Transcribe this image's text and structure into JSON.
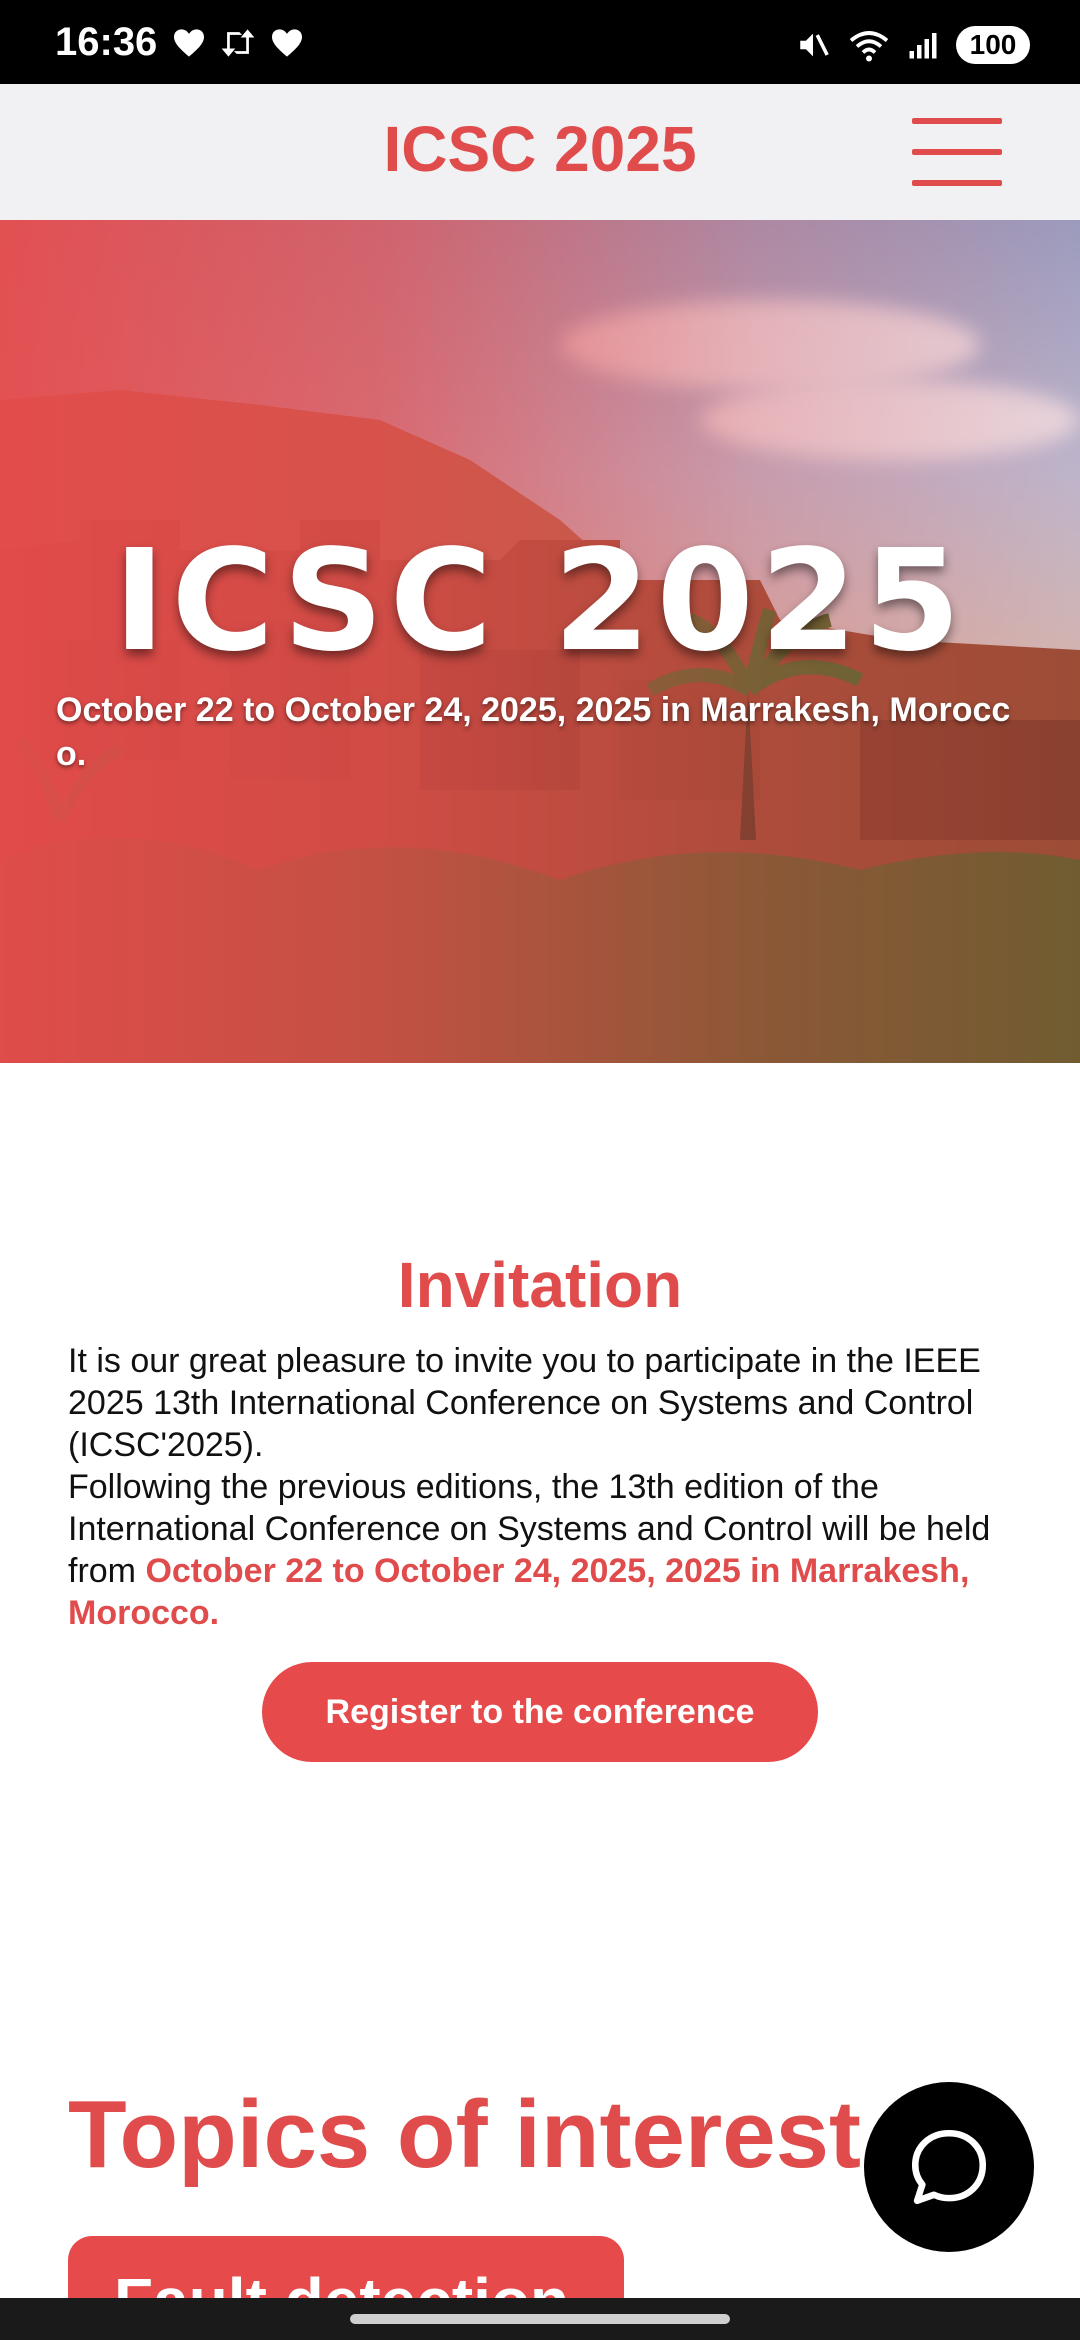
{
  "status_bar": {
    "time": "16:36",
    "left_icons": [
      "heart-icon",
      "repost-icon",
      "heart-icon"
    ],
    "right_icons": [
      "mute-icon",
      "wifi-icon",
      "signal-icon"
    ],
    "battery": "100"
  },
  "app_bar": {
    "title": "ICSC 2025",
    "menu_icon": "hamburger-menu-icon"
  },
  "hero": {
    "title": "ICSC 2025",
    "subtitle": "October 22 to October 24, 2025, 2025 in Marrakesh, Morocco."
  },
  "invitation": {
    "title": "Invitation",
    "line1": "It is our great pleasure to invite you to participate in the IEEE 2025 13th International Conference on Systems and Control (ICSC'2025).",
    "line2": "Following the previous editions, the 13th edition of the International Conference on Systems and Control will be held from ",
    "highlight": "October 22 to October 24, 2025, 2025 in Marrakesh, Morocco.",
    "register_label": "Register to the conference"
  },
  "topics": {
    "title": "Topics of interest",
    "first_topic": "Fault detection"
  },
  "chat": {
    "icon": "chat-bubble-icon"
  },
  "colors": {
    "accent": "#e04b4b",
    "button": "#e64a4a"
  }
}
